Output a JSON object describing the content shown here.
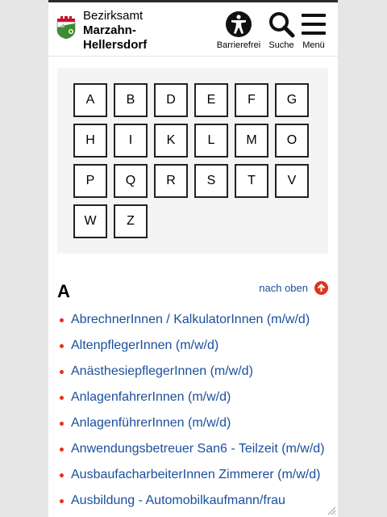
{
  "header": {
    "brand_line1": "Bezirksamt",
    "brand_line2": "Marzahn-",
    "brand_line3": "Hellersdorf",
    "buttons": [
      {
        "label": "Barrierefrei",
        "icon": "accessibility-icon"
      },
      {
        "label": "Suche",
        "icon": "search-icon"
      },
      {
        "label": "Menü",
        "icon": "menu-icon"
      }
    ]
  },
  "alphabet": [
    "A",
    "B",
    "D",
    "E",
    "F",
    "G",
    "H",
    "I",
    "K",
    "L",
    "M",
    "O",
    "P",
    "Q",
    "R",
    "S",
    "T",
    "V",
    "W",
    "Z"
  ],
  "section": {
    "title": "A",
    "to_top_label": "nach oben"
  },
  "jobs": [
    "AbrechnerInnen / KalkulatorInnen (m/w/d)",
    "AltenpflegerInnen (m/w/d)",
    "AnästhesiepflegerInnen (m/w/d)",
    "AnlagenfahrerInnen (m/w/d)",
    "AnlagenführerInnen (m/w/d)",
    "Anwendungsbetreuer San6 - Teilzeit (m/w/d)",
    "AusbaufacharbeiterInnen Zimmerer (m/w/d)",
    "Ausbildung - Automobilkaufmann/frau"
  ],
  "colors": {
    "accent": "#e0341a",
    "link": "#1a4f9c",
    "panel": "#f4f4f4"
  }
}
